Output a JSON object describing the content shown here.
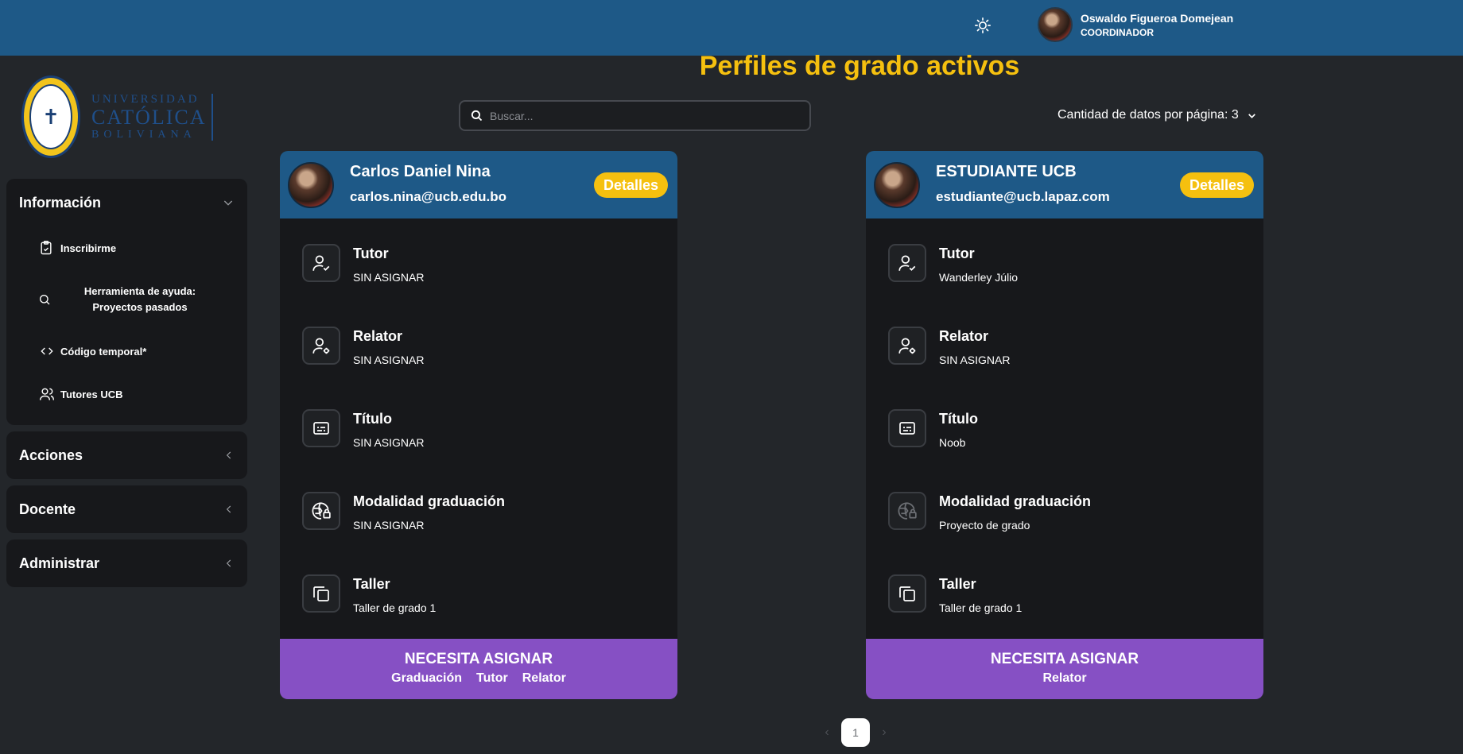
{
  "header": {
    "user_name": "Oswaldo Figueroa Domejean",
    "user_role": "COORDINADOR",
    "theme_icon": "sun-icon"
  },
  "logo": {
    "line1": "UNIVERSIDAD",
    "line2": "CATÓLICA",
    "line3": "BOLIVIANA"
  },
  "sidebar": {
    "informacion": {
      "title": "Información",
      "items": [
        {
          "label": "Inscribirme",
          "icon": "clipboard-icon"
        },
        {
          "label": "Herramienta de ayuda: Proyectos pasados",
          "icon": "search-icon"
        },
        {
          "label": "Código temporal*",
          "icon": "code-icon"
        },
        {
          "label": "Tutores UCB",
          "icon": "users-icon"
        }
      ]
    },
    "acciones": "Acciones",
    "docente": "Docente",
    "administrar": "Administrar"
  },
  "main": {
    "title": "Perfiles de grado activos",
    "search_placeholder": "Buscar...",
    "per_page_label": "Cantidad de datos por página: 3",
    "pagination": {
      "current": "1"
    }
  },
  "cards": [
    {
      "name": "Carlos Daniel Nina",
      "email": "carlos.nina@ucb.edu.bo",
      "details": "Detalles",
      "fields": [
        {
          "label": "Tutor",
          "value": "SIN ASIGNAR",
          "icon": "user-check-icon"
        },
        {
          "label": "Relator",
          "value": "SIN ASIGNAR",
          "icon": "user-gear-icon"
        },
        {
          "label": "Título",
          "value": "SIN ASIGNAR",
          "icon": "caption-icon"
        },
        {
          "label": "Modalidad graduación",
          "value": "SIN ASIGNAR",
          "icon": "globe-lock-icon"
        },
        {
          "label": "Taller",
          "value": "Taller de grado 1",
          "icon": "copy-icon"
        }
      ],
      "footer_title": "NECESITA ASIGNAR",
      "footer_items": [
        "Graduación",
        "Tutor",
        "Relator"
      ]
    },
    {
      "name": "ESTUDIANTE UCB",
      "email": "estudiante@ucb.lapaz.com",
      "details": "Detalles",
      "fields": [
        {
          "label": "Tutor",
          "value": "Wanderley Júlio",
          "icon": "user-check-icon"
        },
        {
          "label": "Relator",
          "value": "SIN ASIGNAR",
          "icon": "user-gear-icon"
        },
        {
          "label": "Título",
          "value": "Noob",
          "icon": "caption-icon"
        },
        {
          "label": "Modalidad graduación",
          "value": "Proyecto de grado",
          "icon": "globe-lock-icon"
        },
        {
          "label": "Taller",
          "value": "Taller de grado 1",
          "icon": "copy-icon"
        }
      ],
      "footer_title": "NECESITA ASIGNAR",
      "footer_items": [
        "Relator"
      ]
    }
  ],
  "colors": {
    "header": "#1e5987",
    "accent": "#f5c00f",
    "footer": "#8650c4",
    "background": "#23262a",
    "panel": "#17181b"
  }
}
